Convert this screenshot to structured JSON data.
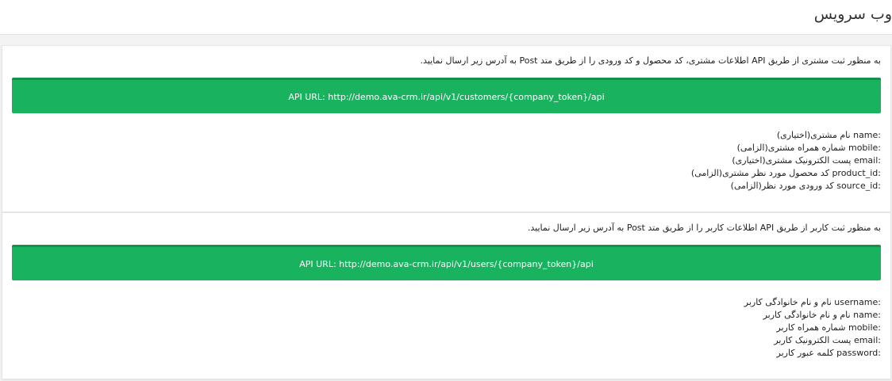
{
  "page": {
    "title": "وب سرویس"
  },
  "customers": {
    "intro": "به منظور ثبت مشتری از طریق API اطلاعات مشتری، کد محصول و کد ورودی را از طریق متد Post به آدرس زیر ارسال نمایید.",
    "api_url": "API URL: http://demo.ava-crm.ir/api/v1/customers/{company_token}/api",
    "fields": [
      {
        "key": "name:",
        "desc": " نام مشتری(اختیاری)"
      },
      {
        "key": "mobile:",
        "desc": " شماره همراه مشتری(الزامی)"
      },
      {
        "key": "email:",
        "desc": " پست الکترونیک مشتری(اختیاری)"
      },
      {
        "key": "product_id:",
        "desc": " کد محصول مورد نظر مشتری(الزامی)"
      },
      {
        "key": "source_id:",
        "desc": " کد ورودی مورد نظر(الزامی)"
      }
    ]
  },
  "users": {
    "intro": "به منظور ثبت کاربر از طریق API اطلاعات کاربر را از طریق متد Post به آدرس زیر ارسال نمایید.",
    "api_url": "API URL: http://demo.ava-crm.ir/api/v1/users/{company_token}/api",
    "fields": [
      {
        "key": "username:",
        "desc": " نام و نام خانوادگی کاربر"
      },
      {
        "key": "name:",
        "desc": " نام و نام خانوادگی کاربر"
      },
      {
        "key": "mobile:",
        "desc": " شماره همراه کاربر"
      },
      {
        "key": "email:",
        "desc": " پست الکترونیک کاربر"
      },
      {
        "key": "password:",
        "desc": " کلمه عبور کاربر"
      }
    ]
  },
  "colors": {
    "accent": "#19b25f",
    "accent_border": "#12924c"
  }
}
